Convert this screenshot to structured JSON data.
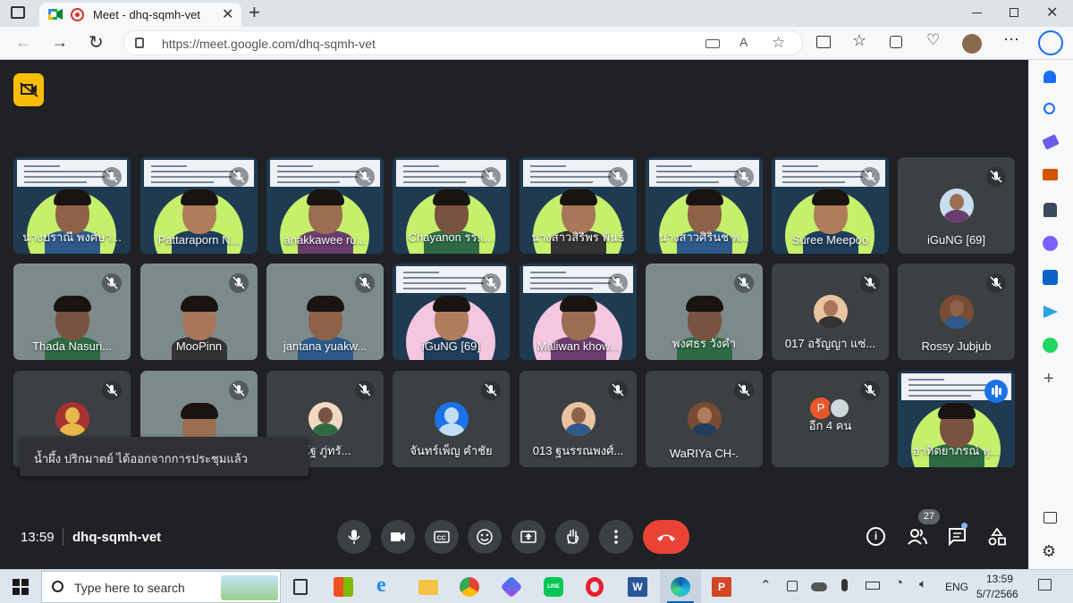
{
  "browser": {
    "tab_title": "Meet - dhq-sqmh-vet",
    "url": "https://meet.google.com/dhq-sqmh-vet"
  },
  "participants": [
    {
      "name": "นางปราณี พงศ์ษา...",
      "kind": "slide"
    },
    {
      "name": "Pattaraporn N...",
      "kind": "slide"
    },
    {
      "name": "anakkawee ru...",
      "kind": "slide"
    },
    {
      "name": "Chayanon รร.เ...",
      "kind": "slide"
    },
    {
      "name": "นางสาวสิริพร พันธ์",
      "kind": "slide"
    },
    {
      "name": "นางสาวศิรินช พ...",
      "kind": "slide"
    },
    {
      "name": "Suree Meepoo",
      "kind": "slide"
    },
    {
      "name": "iGuNG [69]",
      "kind": "avatar"
    },
    {
      "name": "Thada Nasuri...",
      "kind": "camera"
    },
    {
      "name": "MooPinn",
      "kind": "camera"
    },
    {
      "name": "jantana yuakw...",
      "kind": "camera"
    },
    {
      "name": "iGuNG [69]",
      "kind": "slide-pink"
    },
    {
      "name": "Maliwan khow...",
      "kind": "slide-pink"
    },
    {
      "name": "พงศธร วังคำ",
      "kind": "camera"
    },
    {
      "name": "017 อรัญญา แซ่...",
      "kind": "avatar"
    },
    {
      "name": "Rossy Jubjub",
      "kind": "avatar"
    },
    {
      "name": "",
      "kind": "avatar"
    },
    {
      "name": "",
      "kind": "camera"
    },
    {
      "name": "ณัฐ ภู่ทรั...",
      "kind": "avatar"
    },
    {
      "name": "จันทร์เพ็ญ คำชัย",
      "kind": "avatar"
    },
    {
      "name": "013 ฐนรรณพงศ์...",
      "kind": "avatar"
    },
    {
      "name": "WaRIYa CH-.",
      "kind": "avatar"
    },
    {
      "name": "อีก 4 คน",
      "kind": "more"
    },
    {
      "name": "อาทิตยาภรณ์ พุ...",
      "kind": "speaking"
    }
  ],
  "more_avatar_letter": "P",
  "toast": "น้ำผึ้ง ปริกมาตย์ ได้ออกจากการประชุมแล้ว",
  "meeting": {
    "time": "13:59",
    "code": "dhq-sqmh-vet",
    "participant_count": "27"
  },
  "taskbar": {
    "search_placeholder": "Type here to search",
    "lang": "ENG",
    "time": "13:59",
    "date": "5/7/2566"
  },
  "colors": {
    "meet_bg": "#202124",
    "tile_bg": "#3c4043",
    "end_call": "#ea4335",
    "speaking_border": "#8ab4f8",
    "slide_green": "#c6f06c",
    "slide_pink": "#f4c6e0",
    "camera_indicator": "#fbbc04"
  }
}
